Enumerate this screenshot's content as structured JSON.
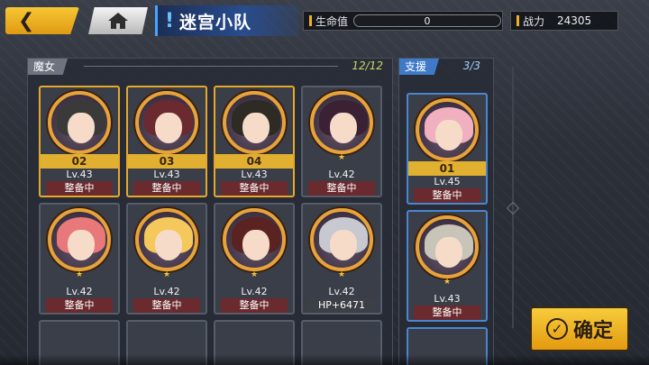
{
  "nav": {
    "back_icon": "back-chevron",
    "home_icon": "home"
  },
  "header": {
    "title_mark": "!",
    "title": "迷宫小队",
    "hp_label": "生命值",
    "hp_value": "0",
    "power_label": "战力",
    "power_value": "24305"
  },
  "witches": {
    "label": "魔女",
    "count": "12/12",
    "cards": [
      {
        "badge": "02",
        "level": "Lv.43",
        "status": "整备中",
        "hair": "#3a3a3a",
        "ring": "#e7a33a"
      },
      {
        "badge": "03",
        "level": "Lv.43",
        "status": "整备中",
        "hair": "#6a2a30",
        "ring": "#e7a33a"
      },
      {
        "badge": "04",
        "level": "Lv.43",
        "status": "整备中",
        "hair": "#2e2a24",
        "ring": "#e7a33a"
      },
      {
        "badge": "",
        "level": "Lv.42",
        "status": "整备中",
        "hair": "#3a2234",
        "ring": "#e7a33a"
      },
      {
        "badge": "",
        "level": "Lv.42",
        "status": "整备中",
        "hair": "#e8787a",
        "ring": "#e7a33a"
      },
      {
        "badge": "",
        "level": "Lv.42",
        "status": "整备中",
        "hair": "#f4c85a",
        "ring": "#e7a33a"
      },
      {
        "badge": "",
        "level": "Lv.42",
        "status": "整备中",
        "hair": "#5a2220",
        "ring": "#e7a33a"
      },
      {
        "badge": "",
        "level": "Lv.42",
        "status": "HP+6471",
        "hair": "#c8c8d0",
        "ring": "#e7a33a"
      }
    ]
  },
  "support": {
    "label": "支援",
    "count": "3/3",
    "cards": [
      {
        "badge": "01",
        "level": "Lv.45",
        "status": "整备中",
        "hair": "#f0b0c0",
        "ring": "#e7a33a"
      },
      {
        "badge": "",
        "level": "Lv.43",
        "status": "整备中",
        "hair": "#c8c4b8",
        "ring": "#e7a33a"
      }
    ]
  },
  "confirm": {
    "icon": "check-circle",
    "label": "确定"
  },
  "colors": {
    "accent": "#f7c734",
    "support_accent": "#3e7ac8",
    "status_bg": "#6a2a2e"
  }
}
